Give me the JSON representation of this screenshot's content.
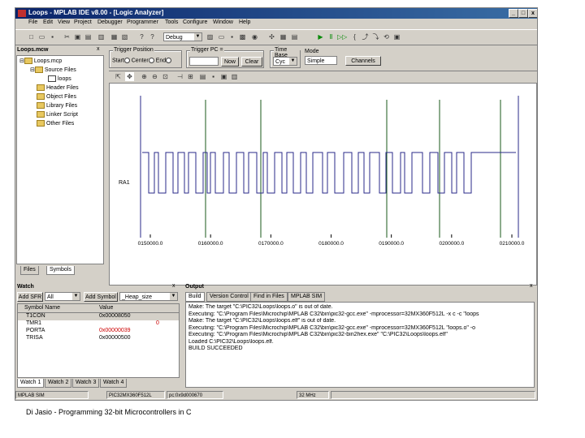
{
  "window": {
    "title": "Loops - MPLAB IDE v8.00 - [Logic Analyzer]"
  },
  "menu": [
    "File",
    "Edit",
    "View",
    "Project",
    "Debugger",
    "Programmer",
    "Tools",
    "Configure",
    "Window",
    "Help"
  ],
  "toolbar": {
    "config": "Debug"
  },
  "project": {
    "title": "Loops.mcw",
    "items": [
      "Loops.mcp",
      "Source Files",
      "loops",
      "Header Files",
      "Object Files",
      "Library Files",
      "Linker Script",
      "Other Files"
    ],
    "tabs": [
      "Files",
      "Symbols"
    ]
  },
  "logic": {
    "trigger_label": "Trigger Position",
    "trigger_options": [
      "Start",
      "Center",
      "End"
    ],
    "trigger_pc_label": "Trigger PC =",
    "now_btn": "Now",
    "clear_btn": "Clear",
    "timebase_label": "Time Base",
    "timebase_value": "Cyc",
    "mode_label": "Mode",
    "mode_value": "Simple",
    "channels_btn": "Channels",
    "channel_name": "RA1",
    "ticks": [
      "0150000.0",
      "0160000.0",
      "0170000.0",
      "0180000.0",
      "0190000.0",
      "0200000.0",
      "0210000.0"
    ]
  },
  "watch": {
    "title": "Watch",
    "add_sfr": "Add SFR",
    "sfr_value": "All",
    "add_symbol": "Add Symbol",
    "symbol_value": "_Heap_size",
    "col_symbol": "Symbol Name",
    "col_value": "Value",
    "rows": [
      {
        "name": "T1CON",
        "value": "0x00008050"
      },
      {
        "name": "TMR1",
        "value": "0"
      },
      {
        "name": "PORTA",
        "value": "0x00000039"
      },
      {
        "name": "TRISA",
        "value": "0x00000500"
      }
    ],
    "tabs": [
      "Watch 1",
      "Watch 2",
      "Watch 3",
      "Watch 4"
    ]
  },
  "output": {
    "title": "Output",
    "tabs": [
      "Build",
      "Version Control",
      "Find in Files",
      "MPLAB SIM"
    ],
    "lines": [
      "Make: The target \"C:\\PIC32\\Loops\\loops.o\" is out of date.",
      "Executing: \"C:\\Program Files\\Microchip\\MPLAB C32\\bin\\pic32-gcc.exe\" -mprocessor=32MX360F512L -x c -c \"loops",
      "Make: The target \"C:\\PIC32\\Loops\\loops.elf\" is out of date.",
      "Executing: \"C:\\Program Files\\Microchip\\MPLAB C32\\bin\\pic32-gcc.exe\" -mprocessor=32MX360F512L \"loops.o\" -o",
      "Executing: \"C:\\Program Files\\Microchip\\MPLAB C32\\bin\\pic32-bin2hex.exe\" \"C:\\PIC32\\Loops\\loops.elf\"",
      "Loaded C:\\PIC32\\Loops\\loops.elf.",
      "BUILD SUCCEEDED"
    ]
  },
  "status": [
    "MPLAB SIM",
    "PIC32MX360F512L",
    "pc:0x9d000670",
    "32 MHz"
  ],
  "footer": "Di Jasio - Programming 32-bit Microcontrollers in C",
  "colors": {
    "trace": "#2a2a8a",
    "grid": "#1a5a1a",
    "title_bar": "#0a246a",
    "value_red": "#cc0000"
  }
}
